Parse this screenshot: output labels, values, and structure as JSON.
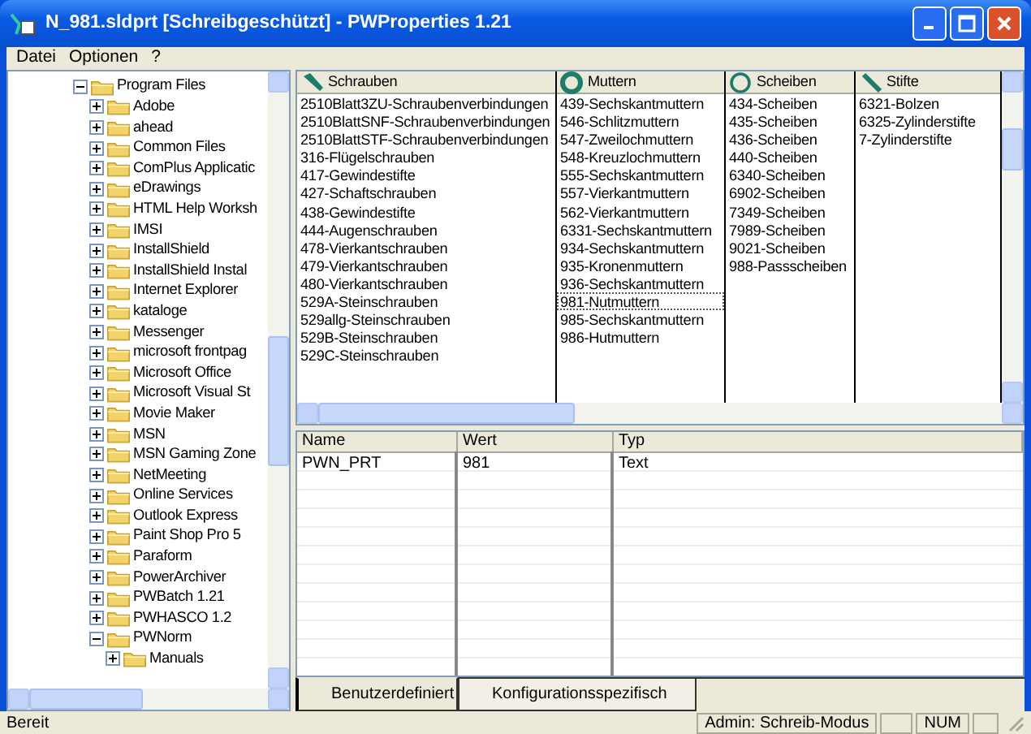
{
  "window": {
    "title": "N_981.sldprt [Schreibgeschützt] - PWProperties 1.21"
  },
  "menu": [
    "Datei",
    "Optionen",
    "?"
  ],
  "tree": [
    {
      "label": "Program Files",
      "expanded": true,
      "children": [
        {
          "label": "Adobe",
          "expanded": false
        },
        {
          "label": "ahead",
          "expanded": false
        },
        {
          "label": "Common Files",
          "expanded": false
        },
        {
          "label": "ComPlus Applicatic",
          "expanded": false
        },
        {
          "label": "eDrawings",
          "expanded": false
        },
        {
          "label": "HTML Help Worksh",
          "expanded": false
        },
        {
          "label": "IMSI",
          "expanded": false
        },
        {
          "label": "InstallShield",
          "expanded": false
        },
        {
          "label": "InstallShield Instal",
          "expanded": false
        },
        {
          "label": "Internet Explorer",
          "expanded": false
        },
        {
          "label": "kataloge",
          "expanded": false
        },
        {
          "label": "Messenger",
          "expanded": false
        },
        {
          "label": "microsoft frontpag",
          "expanded": false
        },
        {
          "label": "Microsoft Office",
          "expanded": false
        },
        {
          "label": "Microsoft Visual St",
          "expanded": false
        },
        {
          "label": "Movie Maker",
          "expanded": false
        },
        {
          "label": "MSN",
          "expanded": false
        },
        {
          "label": "MSN Gaming Zone",
          "expanded": false
        },
        {
          "label": "NetMeeting",
          "expanded": false
        },
        {
          "label": "Online Services",
          "expanded": false
        },
        {
          "label": "Outlook Express",
          "expanded": false
        },
        {
          "label": "Paint Shop Pro 5",
          "expanded": false
        },
        {
          "label": "Paraform",
          "expanded": false
        },
        {
          "label": "PowerArchiver",
          "expanded": false
        },
        {
          "label": "PWBatch 1.21",
          "expanded": false
        },
        {
          "label": "PWHASCO 1.2",
          "expanded": false
        },
        {
          "label": "PWNorm",
          "expanded": true,
          "children": [
            {
              "label": "Manuals",
              "expanded": false
            }
          ]
        }
      ]
    }
  ],
  "part_columns": [
    {
      "title": "Schrauben",
      "kind": "screw",
      "items": [
        {
          "label": "2510Blatt3ZU-Schraubenverbindungen",
          "selected": false
        },
        {
          "label": "2510BlattSNF-Schraubenverbindungen",
          "selected": false
        },
        {
          "label": "2510BlattSTF-Schraubenverbindungen",
          "selected": false
        },
        {
          "label": "316-Flügelschrauben",
          "selected": false
        },
        {
          "label": "417-Gewindestifte",
          "selected": false
        },
        {
          "label": "427-Schaftschrauben",
          "selected": false
        },
        {
          "label": "438-Gewindestifte",
          "selected": false
        },
        {
          "label": "444-Augenschrauben",
          "selected": false
        },
        {
          "label": "478-Vierkantschrauben",
          "selected": false
        },
        {
          "label": "479-Vierkantschrauben",
          "selected": false
        },
        {
          "label": "480-Vierkantschrauben",
          "selected": false
        },
        {
          "label": "529A-Steinschrauben",
          "selected": false
        },
        {
          "label": "529allg-Steinschrauben",
          "selected": false
        },
        {
          "label": "529B-Steinschrauben",
          "selected": false
        },
        {
          "label": "529C-Steinschrauben",
          "selected": false
        }
      ]
    },
    {
      "title": "Muttern",
      "kind": "nut",
      "items": [
        {
          "label": "439-Sechskantmuttern",
          "selected": false
        },
        {
          "label": "546-Schlitzmuttern",
          "selected": false
        },
        {
          "label": "547-Zweilochmuttern",
          "selected": false
        },
        {
          "label": "548-Kreuzlochmuttern",
          "selected": false
        },
        {
          "label": "555-Sechskantmuttern",
          "selected": false
        },
        {
          "label": "557-Vierkantmuttern",
          "selected": false
        },
        {
          "label": "562-Vierkantmuttern",
          "selected": false
        },
        {
          "label": "6331-Sechskantmuttern",
          "selected": false
        },
        {
          "label": "934-Sechskantmuttern",
          "selected": false
        },
        {
          "label": "935-Kronenmuttern",
          "selected": false
        },
        {
          "label": "936-Sechskantmuttern",
          "selected": false
        },
        {
          "label": "981-Nutmuttern",
          "selected": true
        },
        {
          "label": "985-Sechskantmuttern",
          "selected": false
        },
        {
          "label": "986-Hutmuttern",
          "selected": false
        }
      ]
    },
    {
      "title": "Scheiben",
      "kind": "washer",
      "items": [
        {
          "label": "434-Scheiben",
          "selected": false
        },
        {
          "label": "435-Scheiben",
          "selected": false
        },
        {
          "label": "436-Scheiben",
          "selected": false
        },
        {
          "label": "440-Scheiben",
          "selected": false
        },
        {
          "label": "6340-Scheiben",
          "selected": false
        },
        {
          "label": "6902-Scheiben",
          "selected": false
        },
        {
          "label": "7349-Scheiben",
          "selected": false
        },
        {
          "label": "7989-Scheiben",
          "selected": false
        },
        {
          "label": "9021-Scheiben",
          "selected": false
        },
        {
          "label": "988-Passscheiben",
          "selected": false
        }
      ]
    },
    {
      "title": "Stifte",
      "kind": "pin",
      "items": [
        {
          "label": "6321-Bolzen",
          "selected": false
        },
        {
          "label": "6325-Zylinderstifte",
          "selected": false
        },
        {
          "label": "7-Zylinderstifte",
          "selected": false
        }
      ]
    }
  ],
  "properties": {
    "columns": [
      "Name",
      "Wert",
      "Typ"
    ],
    "rows": [
      [
        "PWN_PRT",
        "981",
        "Text"
      ]
    ]
  },
  "tabs": [
    {
      "label": "Benutzerdefiniert",
      "selected": true
    },
    {
      "label": "Konfigurationsspezifisch",
      "selected": false
    }
  ],
  "status_bar": {
    "message": "Bereit",
    "mode": "Admin: Schreib-Modus",
    "num": "NUM"
  }
}
